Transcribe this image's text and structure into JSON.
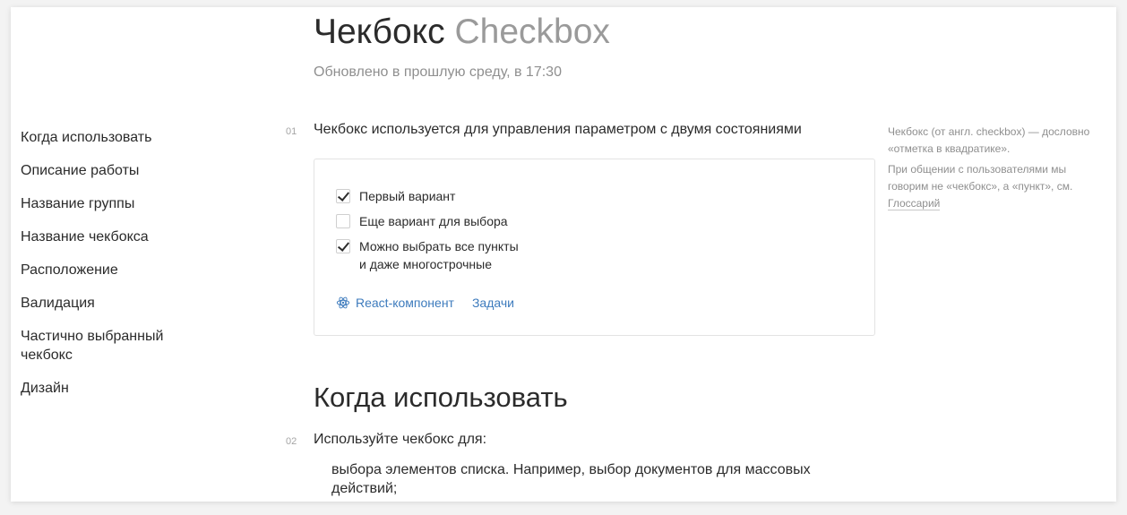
{
  "page": {
    "title_ru": "Чекбокс",
    "title_en": "Checkbox",
    "updated": "Обновлено в прошлую среду, в 17:30"
  },
  "sidebar": {
    "items": [
      {
        "label": "Когда использовать"
      },
      {
        "label": "Описание работы"
      },
      {
        "label": "Название группы"
      },
      {
        "label": "Название чекбокса"
      },
      {
        "label": "Расположение"
      },
      {
        "label": "Валидация"
      },
      {
        "label": "Частично выбранный чекбокс"
      },
      {
        "label": "Дизайн"
      }
    ]
  },
  "section1": {
    "number": "01",
    "intro": "Чекбокс используется для управления параметром с двумя состояниями",
    "demo": {
      "checkboxes": [
        {
          "label": "Первый вариант",
          "checked": true
        },
        {
          "label": "Еще вариант для выбора",
          "checked": false
        },
        {
          "label": "Можно выбрать все пункты",
          "label_line2": "и даже многострочные",
          "checked": true
        }
      ],
      "links": {
        "react": "React-компонент",
        "tasks": "Задачи"
      }
    },
    "note": {
      "p1": "Чекбокс (от англ. checkbox) — дословно «отметка в квадратике».",
      "p2": "При общении с пользователями мы говорим не «чекбокс», а «пункт», см.",
      "glossary": "Глоссарий"
    }
  },
  "section2": {
    "heading": "Когда использовать",
    "number": "02",
    "intro": "Используйте чекбокс для:",
    "item1": "выбора элементов списка. Например, выбор документов для массовых действий;"
  },
  "colors": {
    "link": "#3d7bbd",
    "muted": "#8f8f8f",
    "text": "#2b2b2b"
  },
  "icons": {
    "react": "react-atom-icon",
    "check": "checkmark-icon"
  }
}
